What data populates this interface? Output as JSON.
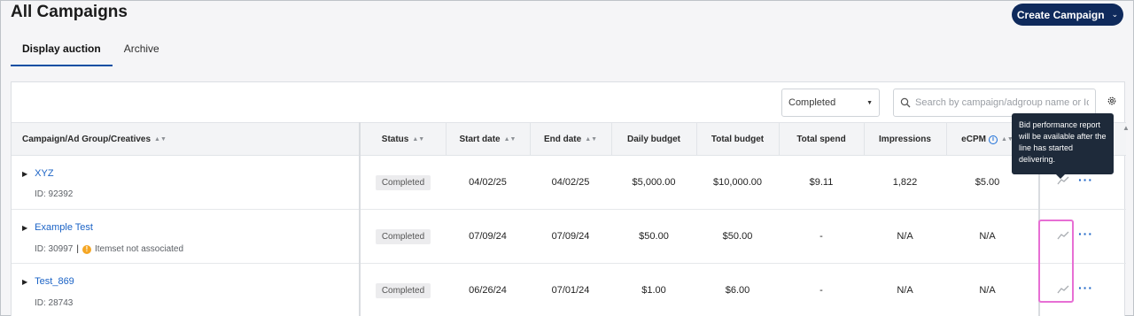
{
  "page": {
    "title": "All Campaigns"
  },
  "create_button": {
    "label": "Create Campaign",
    "icon": "chevron-down-icon"
  },
  "tabs": [
    {
      "label": "Display auction",
      "active": true
    },
    {
      "label": "Archive",
      "active": false
    }
  ],
  "toolbar": {
    "status_filter": "Completed",
    "search_placeholder": "Search by campaign/adgroup name or Id",
    "settings_icon": "gear-icon"
  },
  "table": {
    "columns": [
      {
        "label": "Campaign/Ad Group/Creatives",
        "sortable": true
      },
      {
        "label": "Status",
        "sortable": true
      },
      {
        "label": "Start date",
        "sortable": true
      },
      {
        "label": "End date",
        "sortable": true
      },
      {
        "label": "Daily budget",
        "sortable": false
      },
      {
        "label": "Total budget",
        "sortable": false
      },
      {
        "label": "Total spend",
        "sortable": false
      },
      {
        "label": "Impressions",
        "sortable": false
      },
      {
        "label": "eCPM",
        "sortable": true,
        "info": true
      }
    ],
    "rows": [
      {
        "name": "XYZ",
        "id": "ID: 92392",
        "warning": "",
        "status": "Completed",
        "start": "04/02/25",
        "end": "04/02/25",
        "daily_budget": "$5,000.00",
        "total_budget": "$10,000.00",
        "total_spend": "$9.11",
        "impressions": "1,822",
        "ecpm": "$5.00"
      },
      {
        "name": "Example Test",
        "id": "ID: 30997",
        "warning": "Itemset not associated",
        "status": "Completed",
        "start": "07/09/24",
        "end": "07/09/24",
        "daily_budget": "$50.00",
        "total_budget": "$50.00",
        "total_spend": "-",
        "impressions": "N/A",
        "ecpm": "N/A"
      },
      {
        "name": "Test_869",
        "id": "ID: 28743",
        "warning": "",
        "status": "Completed",
        "start": "06/26/24",
        "end": "07/01/24",
        "daily_budget": "$1.00",
        "total_budget": "$6.00",
        "total_spend": "-",
        "impressions": "N/A",
        "ecpm": "N/A"
      }
    ]
  },
  "tooltip": {
    "text": "Bid performance report will be available after the line has started delivering."
  },
  "colors": {
    "primary": "#0f2a5c",
    "link": "#1b63c6",
    "highlight": "#e76fd4",
    "warning": "#f5a623"
  }
}
